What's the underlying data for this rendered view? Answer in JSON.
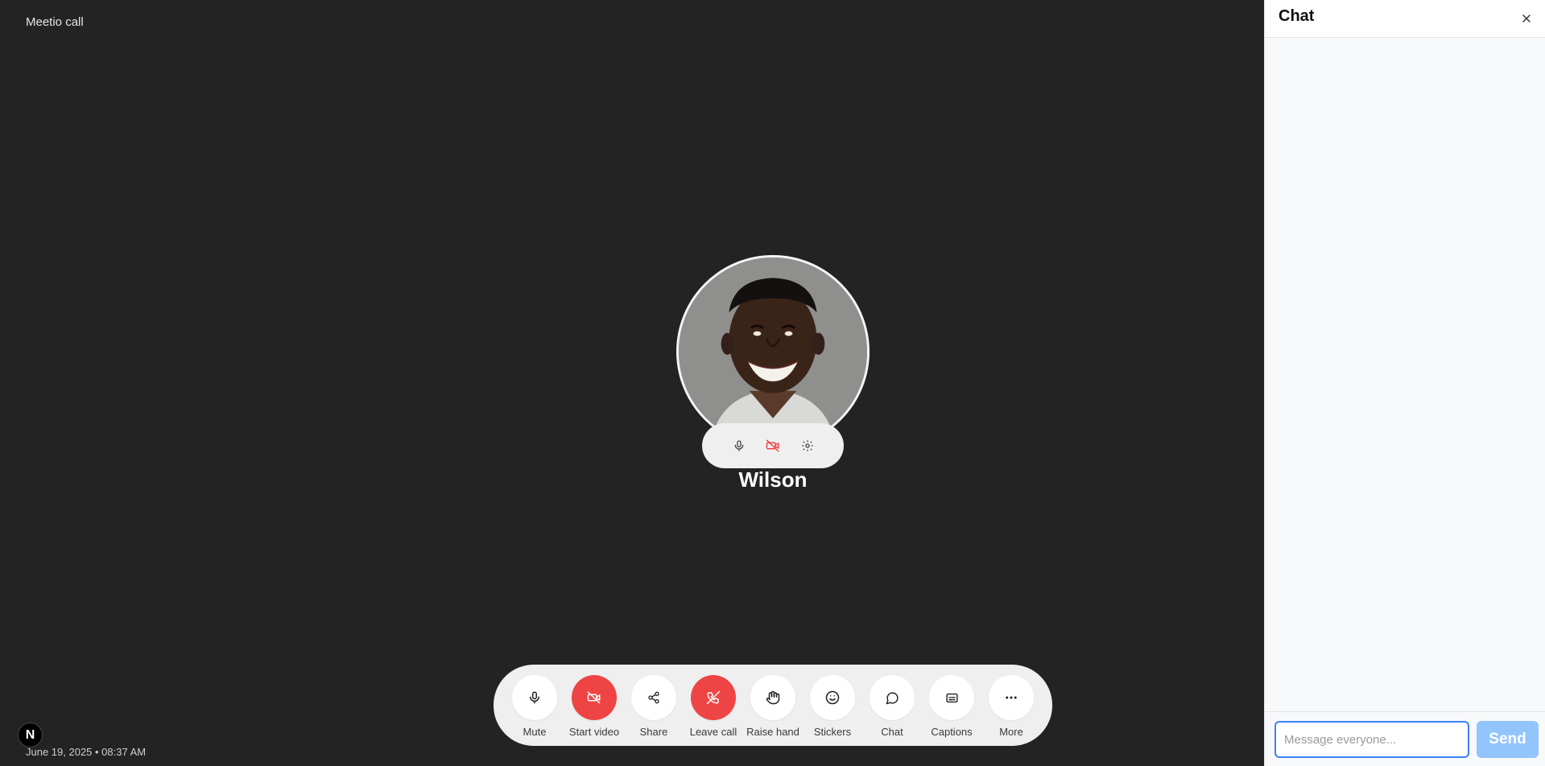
{
  "app": {
    "title": "Meetio call"
  },
  "participant": {
    "name": "Wilson",
    "avatar_icon": "participant-photo",
    "controls": [
      {
        "icon": "microphone-icon",
        "color": "#444444"
      },
      {
        "icon": "video-off-icon",
        "color": "#ef4444"
      },
      {
        "icon": "gear-icon",
        "color": "#444444"
      }
    ]
  },
  "toolbar": {
    "items": [
      {
        "label": "Mute",
        "icon": "microphone-icon",
        "style": "default"
      },
      {
        "label": "Start video",
        "icon": "video-off-icon",
        "style": "red"
      },
      {
        "label": "Share",
        "icon": "share-icon",
        "style": "default"
      },
      {
        "label": "Leave call",
        "icon": "phone-off-icon",
        "style": "red"
      },
      {
        "label": "Raise hand",
        "icon": "hand-icon",
        "style": "default"
      },
      {
        "label": "Stickers",
        "icon": "smiley-icon",
        "style": "default"
      },
      {
        "label": "Chat",
        "icon": "chat-bubble-icon",
        "style": "default"
      },
      {
        "label": "Captions",
        "icon": "captions-icon",
        "style": "default"
      },
      {
        "label": "More",
        "icon": "more-dots-icon",
        "style": "default"
      }
    ]
  },
  "footer": {
    "badge": "N",
    "datetime": "June 19, 2025 • 08:37 AM"
  },
  "chat": {
    "title": "Chat",
    "input_placeholder": "Message everyone...",
    "input_value": "",
    "send_label": "Send"
  },
  "colors": {
    "stage_bg": "#232323",
    "danger": "#ef4444",
    "send_disabled": "#93c5fd",
    "input_focus": "#3b82f6"
  }
}
